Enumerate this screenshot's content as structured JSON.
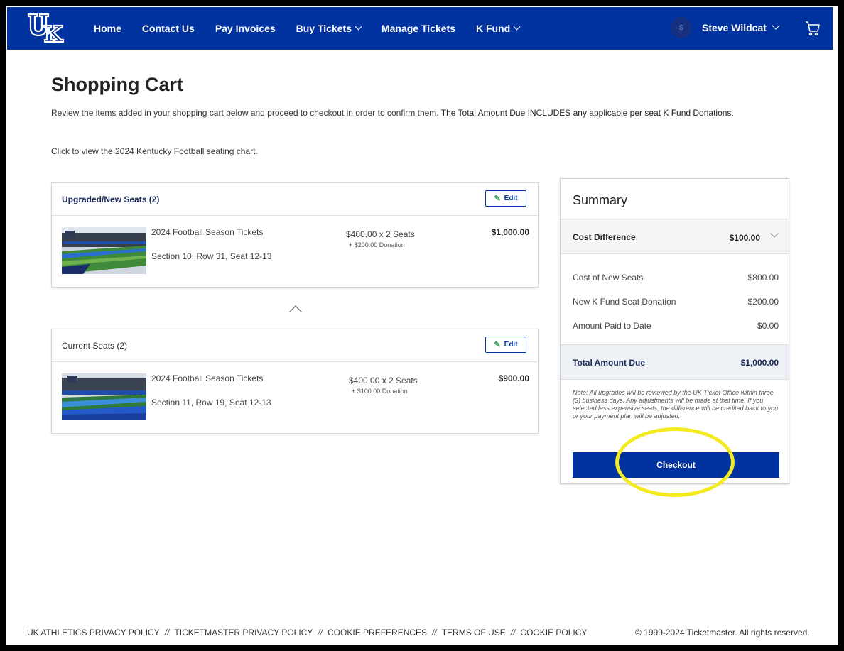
{
  "nav": {
    "links": [
      {
        "label": "Home"
      },
      {
        "label": "Contact Us"
      },
      {
        "label": "Pay Invoices"
      },
      {
        "label": "Buy Tickets",
        "dropdown": true
      },
      {
        "label": "Manage Tickets"
      },
      {
        "label": "K Fund",
        "dropdown": true
      }
    ],
    "user_initial": "S",
    "user_name": "Steve Wildcat"
  },
  "page": {
    "title": "Shopping Cart",
    "intro_normal": "Review the items added in your shopping cart below and proceed to checkout in order to confirm them. ",
    "intro_bold": "The Total Amount Due INCLUDES any applicable per seat K Fund Donations.",
    "chart_link": "Click to view the 2024 Kentucky Football seating chart."
  },
  "upgraded": {
    "header": "Upgraded/New Seats (2)",
    "edit_label": "Edit",
    "item_name": "2024 Football Season Tickets",
    "seat": "Section 10, Row 31, Seat 12-13",
    "price": "$400.00 x 2 Seats",
    "donation": "+ $200.00 Donation",
    "total": "$1,000.00"
  },
  "current": {
    "header": "Current Seats (2)",
    "edit_label": "Edit",
    "item_name": "2024 Football Season Tickets",
    "seat": "Section 11, Row 19, Seat 12-13",
    "price": "$400.00 x 2 Seats",
    "donation": "+ $100.00 Donation",
    "total": "$900.00"
  },
  "summary": {
    "title": "Summary",
    "cost_difference_label": "Cost Difference",
    "cost_difference_value": "$100.00",
    "rows": [
      {
        "label": "Cost of New Seats",
        "value": "$800.00"
      },
      {
        "label": "New K Fund Seat Donation",
        "value": "$200.00"
      },
      {
        "label": "Amount Paid to Date",
        "value": "$0.00"
      }
    ],
    "total_label": "Total Amount Due",
    "total_value": "$1,000.00",
    "note": "Note: All upgrades will be reviewed by the UK Ticket Office within three (3) business days. Any adjustments will be made at that time. If you selected less expensive seats, the difference will be credited back to you or your payment plan will be adjusted.",
    "checkout_label": "Checkout"
  },
  "footer": {
    "links": [
      "UK ATHLETICS PRIVACY POLICY",
      "TICKETMASTER PRIVACY POLICY",
      "COOKIE PREFERENCES",
      "TERMS OF USE",
      "COOKIE POLICY"
    ],
    "separator": "//",
    "copyright": "© 1999-2024 Ticketmaster. All rights reserved."
  },
  "colors": {
    "brand_blue": "#0033a0",
    "highlight": "#f3ea1f"
  }
}
